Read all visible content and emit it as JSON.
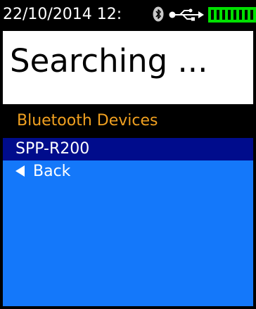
{
  "status_bar": {
    "datetime": "22/10/2014  12:",
    "icons": [
      "bluetooth-icon",
      "usb-icon",
      "battery-icon"
    ],
    "battery_color": "#00e000"
  },
  "title": "Searching ...",
  "section_header": "Bluetooth Devices",
  "devices": [
    {
      "label": "SPP-R200",
      "selected": true
    }
  ],
  "back": {
    "label": "Back",
    "icon": "triangle-left-icon"
  },
  "colors": {
    "accent": "#f0a020",
    "list_background": "#1478fa",
    "selected_background": "#000c8c"
  }
}
